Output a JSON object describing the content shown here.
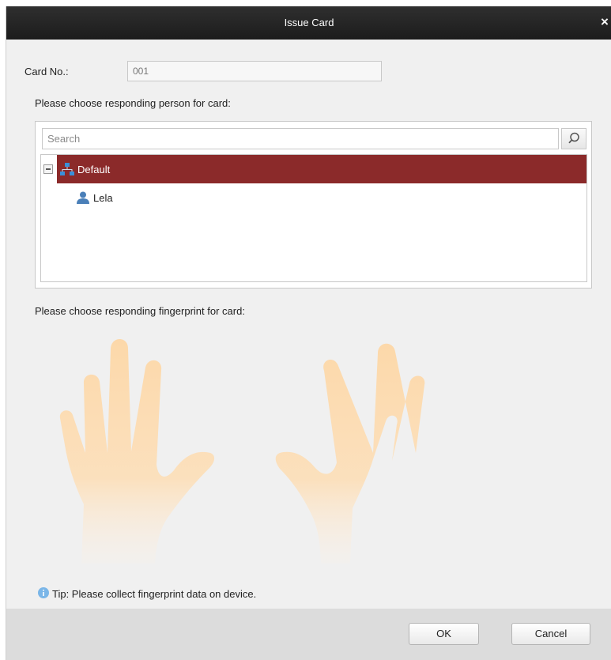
{
  "window": {
    "title": "Issue Card",
    "close_symbol": "×"
  },
  "card_no": {
    "label": "Card No.:",
    "value": "001"
  },
  "person_section": {
    "prompt": "Please choose responding person for card:",
    "search_placeholder": "Search",
    "tree": [
      {
        "label": "Default",
        "icon": "organization-icon",
        "expanded": true,
        "selected": true,
        "children": [
          {
            "label": "Lela",
            "icon": "person-icon"
          }
        ]
      }
    ],
    "root_label": "Default",
    "child_label": "Lela"
  },
  "fingerprint_section": {
    "prompt": "Please choose responding fingerprint for card:",
    "icon": "hands-illustration",
    "hand_color": "#fdd7a6"
  },
  "tip": {
    "icon": "info-icon",
    "text": "Tip: Please collect fingerprint data on device."
  },
  "buttons": {
    "ok": "OK",
    "cancel": "Cancel"
  },
  "colors": {
    "titlebar": "#232323",
    "selection": "#8b2a2a",
    "dialog_bg": "#f0f0f0",
    "footer_bg": "#dcdcdc"
  }
}
